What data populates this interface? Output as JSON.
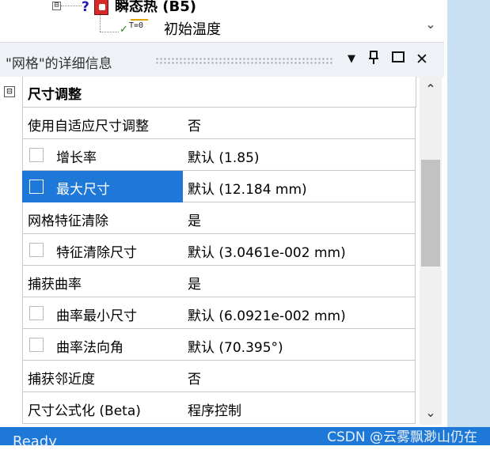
{
  "tree": {
    "expander": "⊟",
    "analysis_icon_prefix": "?",
    "analysis_label": "瞬态热 (B5)",
    "init_icon": "T=0",
    "init_label": "初始温度",
    "scroll_down": "⌄"
  },
  "details": {
    "title": "\"网格\"的详细信息",
    "buttons": {
      "dropdown": "▼",
      "pin": "ᵽ",
      "maximize": "☐",
      "close": "✕"
    }
  },
  "grid": {
    "section": {
      "expander": "⊟",
      "title": "尺寸调整"
    },
    "rows": [
      {
        "name": "使用自适应尺寸调整",
        "value": "否",
        "checkbox": false,
        "selected": false
      },
      {
        "name": "增长率",
        "value": "默认 (1.85)",
        "checkbox": true,
        "selected": false
      },
      {
        "name": "最大尺寸",
        "value": "默认 (12.184 mm)",
        "checkbox": true,
        "selected": true
      },
      {
        "name": "网格特征清除",
        "value": "是",
        "checkbox": false,
        "selected": false
      },
      {
        "name": "特征清除尺寸",
        "value": "默认 (3.0461e-002 mm)",
        "checkbox": true,
        "selected": false
      },
      {
        "name": "捕获曲率",
        "value": "是",
        "checkbox": false,
        "selected": false
      },
      {
        "name": "曲率最小尺寸",
        "value": "默认 (6.0921e-002 mm)",
        "checkbox": true,
        "selected": false
      },
      {
        "name": "曲率法向角",
        "value": "默认 (70.395°)",
        "checkbox": true,
        "selected": false
      },
      {
        "name": "捕获邻近度",
        "value": "否",
        "checkbox": false,
        "selected": false
      },
      {
        "name": "尺寸公式化 (Beta)",
        "value": "程序控制",
        "checkbox": false,
        "selected": false
      }
    ]
  },
  "scrollbar": {
    "up": "⌃",
    "down": "⌄"
  },
  "status": {
    "text": "Ready",
    "watermark": "CSDN @云雾飘渺山仍在"
  },
  "colors": {
    "accent": "#1e78d7",
    "strip": "#c9dff2"
  }
}
